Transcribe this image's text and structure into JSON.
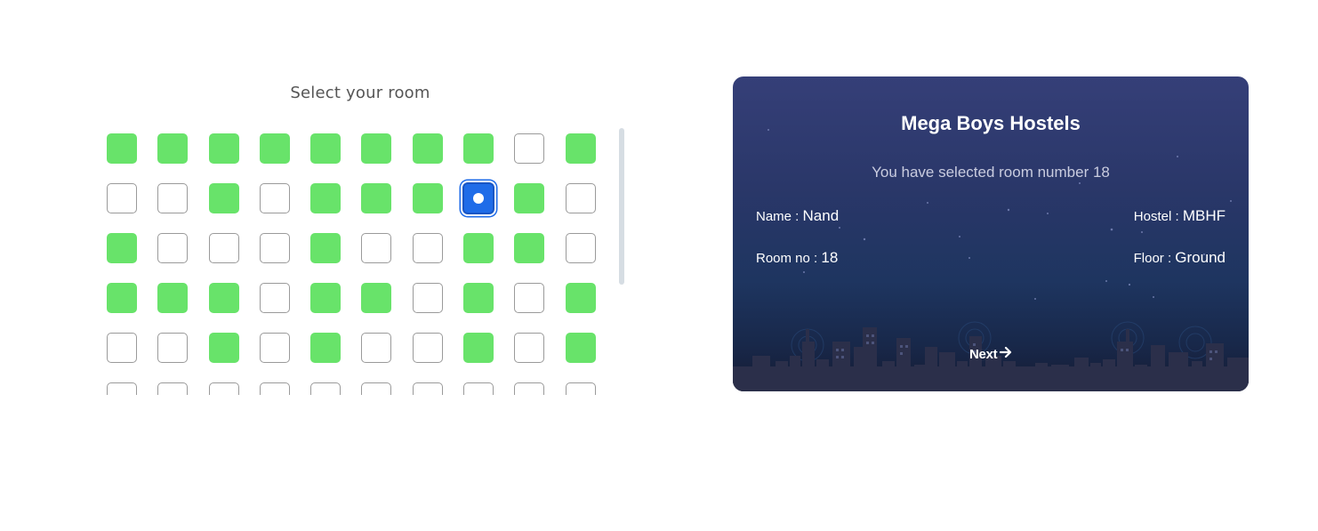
{
  "room_picker": {
    "title": "Select your room",
    "selected_room": 18,
    "rows": [
      [
        "occupied",
        "occupied",
        "occupied",
        "occupied",
        "occupied",
        "occupied",
        "occupied",
        "occupied",
        "available",
        "occupied"
      ],
      [
        "available",
        "available",
        "occupied",
        "available",
        "occupied",
        "occupied",
        "occupied",
        "selected",
        "occupied",
        "available"
      ],
      [
        "occupied",
        "available",
        "available",
        "available",
        "occupied",
        "available",
        "available",
        "occupied",
        "occupied",
        "available"
      ],
      [
        "occupied",
        "occupied",
        "occupied",
        "available",
        "occupied",
        "occupied",
        "available",
        "occupied",
        "available",
        "occupied"
      ],
      [
        "available",
        "available",
        "occupied",
        "available",
        "occupied",
        "available",
        "available",
        "occupied",
        "available",
        "occupied"
      ],
      [
        "available",
        "available",
        "available",
        "available",
        "available",
        "available",
        "available",
        "available",
        "available",
        "available"
      ]
    ],
    "colors": {
      "occupied": "#68e36a",
      "available": "#ffffff",
      "selected": "#1f6ce8"
    }
  },
  "card": {
    "title": "Mega Boys Hostels",
    "subtitle": "You have selected room number 18",
    "name_label": "Name : ",
    "name_value": "Nand",
    "hostel_label": "Hostel : ",
    "hostel_value": "MBHF",
    "room_label": "Room no : ",
    "room_value": "18",
    "floor_label": "Floor : ",
    "floor_value": "Ground",
    "next_label": "Next",
    "next_icon": "arrow-right-icon"
  }
}
